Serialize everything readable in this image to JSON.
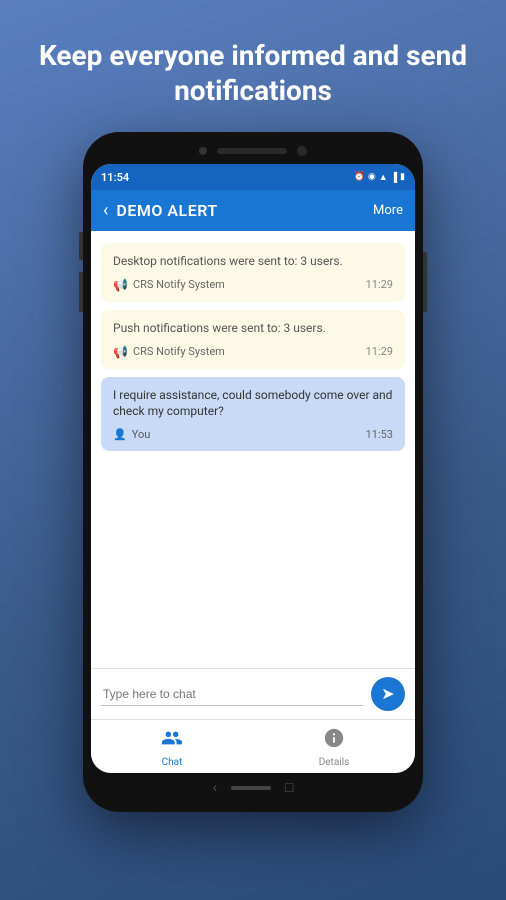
{
  "page": {
    "headline": "Keep everyone informed and send notifications"
  },
  "status_bar": {
    "time": "11:54",
    "icons": [
      "alarm",
      "location",
      "wifi",
      "signal",
      "battery"
    ]
  },
  "app_header": {
    "title": "DEMO ALERT",
    "back_label": "‹",
    "more_label": "More"
  },
  "messages": [
    {
      "id": 1,
      "type": "system",
      "text": "Desktop notifications were sent to: 3 users.",
      "sender": "CRS Notify System",
      "time": "11:29"
    },
    {
      "id": 2,
      "type": "system",
      "text": "Push notifications were sent to: 3 users.",
      "sender": "CRS Notify System",
      "time": "11:29"
    },
    {
      "id": 3,
      "type": "user",
      "text": "I require assistance, could somebody come over and check my computer?",
      "sender": "You",
      "time": "11:53"
    }
  ],
  "input": {
    "placeholder": "Type here to chat"
  },
  "bottom_nav": {
    "items": [
      {
        "label": "Chat",
        "icon": "people",
        "active": true
      },
      {
        "label": "Details",
        "icon": "info",
        "active": false
      }
    ]
  }
}
